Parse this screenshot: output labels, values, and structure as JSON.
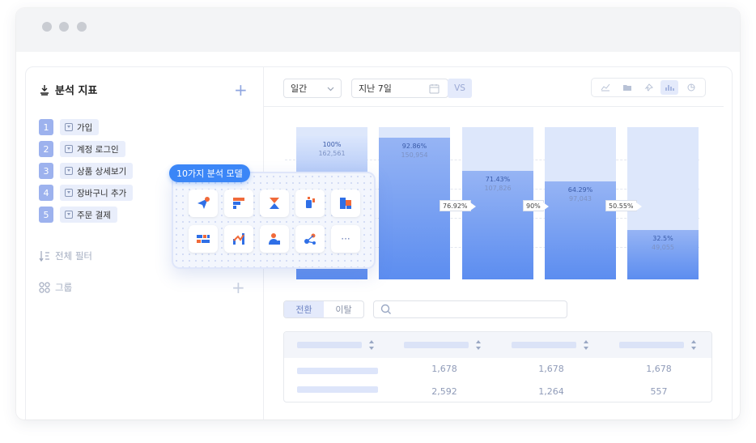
{
  "sidebar": {
    "title": "분석 지표",
    "add_label": "+",
    "metrics": [
      {
        "num": "1",
        "label": "가입"
      },
      {
        "num": "2",
        "label": "계정 로그인"
      },
      {
        "num": "3",
        "label": "상품 상세보기"
      },
      {
        "num": "4",
        "label": "장바구니 추가"
      },
      {
        "num": "5",
        "label": "주문 결제"
      }
    ],
    "filter_label": "전체 필터",
    "group_label": "그룹"
  },
  "popup": {
    "badge": "10가지 분석 모델",
    "more_label": "···"
  },
  "toolbar": {
    "period_select": "일간",
    "range_select": "지난 7일",
    "vs_label": "VS"
  },
  "funnel": {
    "steps": [
      {
        "pct": "100%",
        "count": "162,561"
      },
      {
        "pct": "92.86%",
        "count": "150,954"
      },
      {
        "pct": "71.43%",
        "count": "107,826"
      },
      {
        "pct": "64.29%",
        "count": "97,043"
      },
      {
        "pct": "32.5%",
        "count": "49,055"
      }
    ],
    "conversions": [
      "76.92%",
      "90%",
      "50.55%"
    ]
  },
  "chart_data": {
    "type": "bar",
    "categories": [
      "1",
      "2",
      "3",
      "4",
      "5"
    ],
    "values": [
      100,
      92.86,
      71.43,
      64.29,
      32.5
    ],
    "counts": [
      162561,
      150954,
      107826,
      97043,
      49055
    ],
    "conversion_rates": [
      76.92,
      90,
      50.55
    ],
    "ylim": [
      0,
      100
    ],
    "colors": {
      "fill": "#6a97f2",
      "background": "#dde7fb"
    }
  },
  "tabs": [
    {
      "label": "전환",
      "active": true
    },
    {
      "label": "이탈",
      "active": false
    }
  ],
  "search": {
    "placeholder": ""
  },
  "table": {
    "rows": [
      [
        "1,678",
        "1,678",
        "1,678"
      ],
      [
        "2,592",
        "1,264",
        "557"
      ]
    ]
  }
}
